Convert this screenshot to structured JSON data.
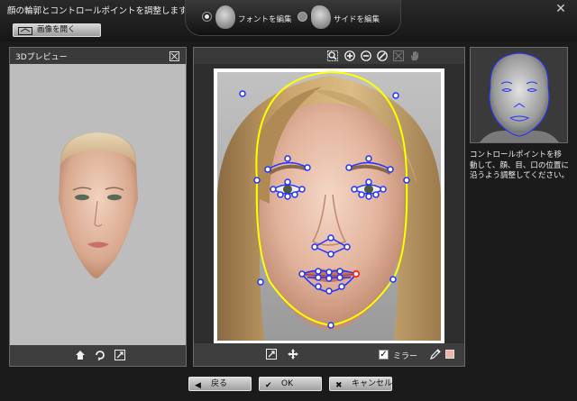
{
  "title": "顔の輪郭とコントロールポイントを調整します。",
  "mode_tabs": [
    {
      "label": "フォントを編集",
      "selected": true,
      "icon": "face-front-icon"
    },
    {
      "label": "サイドを編集",
      "selected": false,
      "icon": "face-side-icon"
    }
  ],
  "open_image_button": {
    "label": "画像を開く",
    "icon": "folder-open-icon"
  },
  "preview": {
    "title": "3Dプレビュー",
    "footer_icons": [
      "home-icon",
      "rotate-icon",
      "fit-icon"
    ]
  },
  "editor": {
    "toolbar_icons": [
      "zoom-region-icon",
      "zoom-in-icon",
      "zoom-out-icon",
      "reset-icon",
      "fit-disabled-icon",
      "hand-disabled-icon"
    ],
    "footer_icons": [
      "fit-view-icon",
      "move-icon"
    ],
    "mirror_label": "ミラー",
    "mirror_checked": true,
    "swatch_color": "#f0b4a8",
    "outline_color": "#ffff00",
    "point_color": "#2233ff",
    "selected_point_color": "#ff2222"
  },
  "help_text": "コントロールポイントを移動して、顔、目、口の位置に沿うよう調整してください。",
  "buttons": {
    "back": {
      "label": "戻る",
      "icon": "◀"
    },
    "ok": {
      "label": "OK",
      "icon": "✔"
    },
    "cancel": {
      "label": "キャンセル",
      "icon": "✖"
    }
  },
  "window_close_icon": "close-icon"
}
